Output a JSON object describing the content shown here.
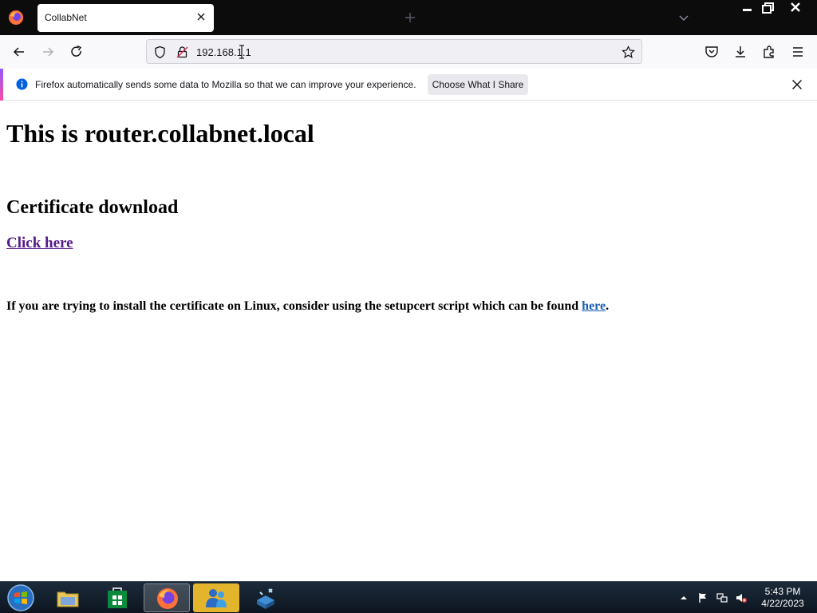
{
  "browser": {
    "tab_title": "CollabNet",
    "url": "192.168.1.1"
  },
  "notification": {
    "message": "Firefox automatically sends some data to Mozilla so that we can improve your experience.",
    "button_label": "Choose What I Share"
  },
  "page": {
    "title": "This is router.collabnet.local",
    "section_heading": "Certificate download",
    "download_link": "Click here",
    "linux_note": "If you are trying to install the certificate on Linux, consider using the setupcert script which can be found",
    "linux_link": "here",
    "linux_note_end": "."
  },
  "taskbar": {
    "time": "5:43 PM",
    "date": "4/22/2023"
  },
  "colors": {
    "visited_link": "#551a8b",
    "link": "#1a5fb4",
    "tab_strip": "#0c0c0d",
    "toolbar": "#f9f9fb"
  }
}
